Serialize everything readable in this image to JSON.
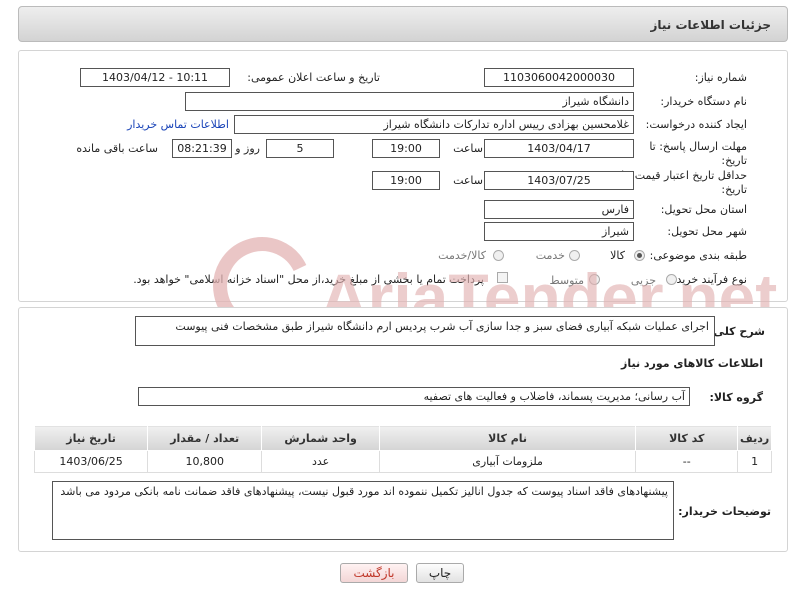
{
  "header": {
    "title": "جزئیات اطلاعات نیاز"
  },
  "form": {
    "need_number": {
      "label": "شماره نیاز:",
      "value": "1103060042000030"
    },
    "announce_datetime": {
      "label": "تاریخ و ساعت اعلان عمومی:",
      "value": "1403/04/12 - 10:11"
    },
    "buyer_org": {
      "label": "نام دستگاه خریدار:",
      "value": "دانشگاه شیراز"
    },
    "requester": {
      "label": "ایجاد کننده درخواست:",
      "value": "غلامحسین بهزادی رییس اداره تدارکات دانشگاه شیراز",
      "contact_link": "اطلاعات تماس خریدار"
    },
    "reply_deadline": {
      "label": "مهلت ارسال پاسخ: تا تاریخ:",
      "date": "1403/04/17",
      "time_label": "ساعت",
      "time": "19:00",
      "days": "5",
      "days_label": "روز و",
      "remaining": "08:21:39",
      "remaining_label": "ساعت باقی مانده"
    },
    "price_validity": {
      "label": "حداقل تاریخ اعتبار قیمت: تا تاریخ:",
      "date": "1403/07/25",
      "time_label": "ساعت",
      "time": "19:00"
    },
    "delivery_province": {
      "label": "استان محل تحویل:",
      "value": "فارس"
    },
    "delivery_city": {
      "label": "شهر محل تحویل:",
      "value": "شیراز"
    },
    "category": {
      "label": "طبقه بندی موضوعی:",
      "options": [
        "کالا",
        "خدمت",
        "کالا/خدمت"
      ],
      "selected": "کالا"
    },
    "process_type": {
      "label": "نوع فرآیند خرید :",
      "options": [
        "جزیی",
        "متوسط"
      ],
      "selected": "",
      "payment_note": "پرداخت تمام یا بخشی از مبلغ خرید،از محل \"اسناد خزانه اسلامی\" خواهد بود."
    }
  },
  "description": {
    "label": "شرح کلی نیاز:",
    "value": "اجرای عملیات شبکه آبیاری فضای سبز و جدا سازی آب شرب  پردیس ارم دانشگاه شیراز طبق مشخصات فنی پیوست"
  },
  "goods": {
    "section_title": "اطلاعات کالاهای مورد نیاز",
    "group_label": "گروه کالا:",
    "group_value": "آب رسانی؛ مدیریت پسماند، فاضلاب و فعالیت های تصفیه",
    "columns": [
      "ردیف",
      "کد کالا",
      "نام کالا",
      "واحد شمارش",
      "تعداد / مقدار",
      "تاریخ نیاز"
    ],
    "rows": [
      {
        "index": "1",
        "code": "--",
        "name": "ملزومات آبیاری",
        "unit": "عدد",
        "qty": "10,800",
        "date": "1403/06/25"
      }
    ]
  },
  "buyer_notes": {
    "label": "توضیحات خریدار:",
    "value": "پیشنهادهای فاقد اسناد پیوست که جدول انالیز تکمیل ننموده اند مورد قبول نیست، پیشنهادهای فاقد ضمانت نامه بانکی مردود می باشد"
  },
  "buttons": {
    "print": "چاپ",
    "back": "بازگشت"
  },
  "watermark": {
    "text": "AriaTender.net"
  },
  "colors": {
    "link": "#1a44b8",
    "back_button_text": "#c0392b",
    "watermark": "#e3b3b3"
  }
}
